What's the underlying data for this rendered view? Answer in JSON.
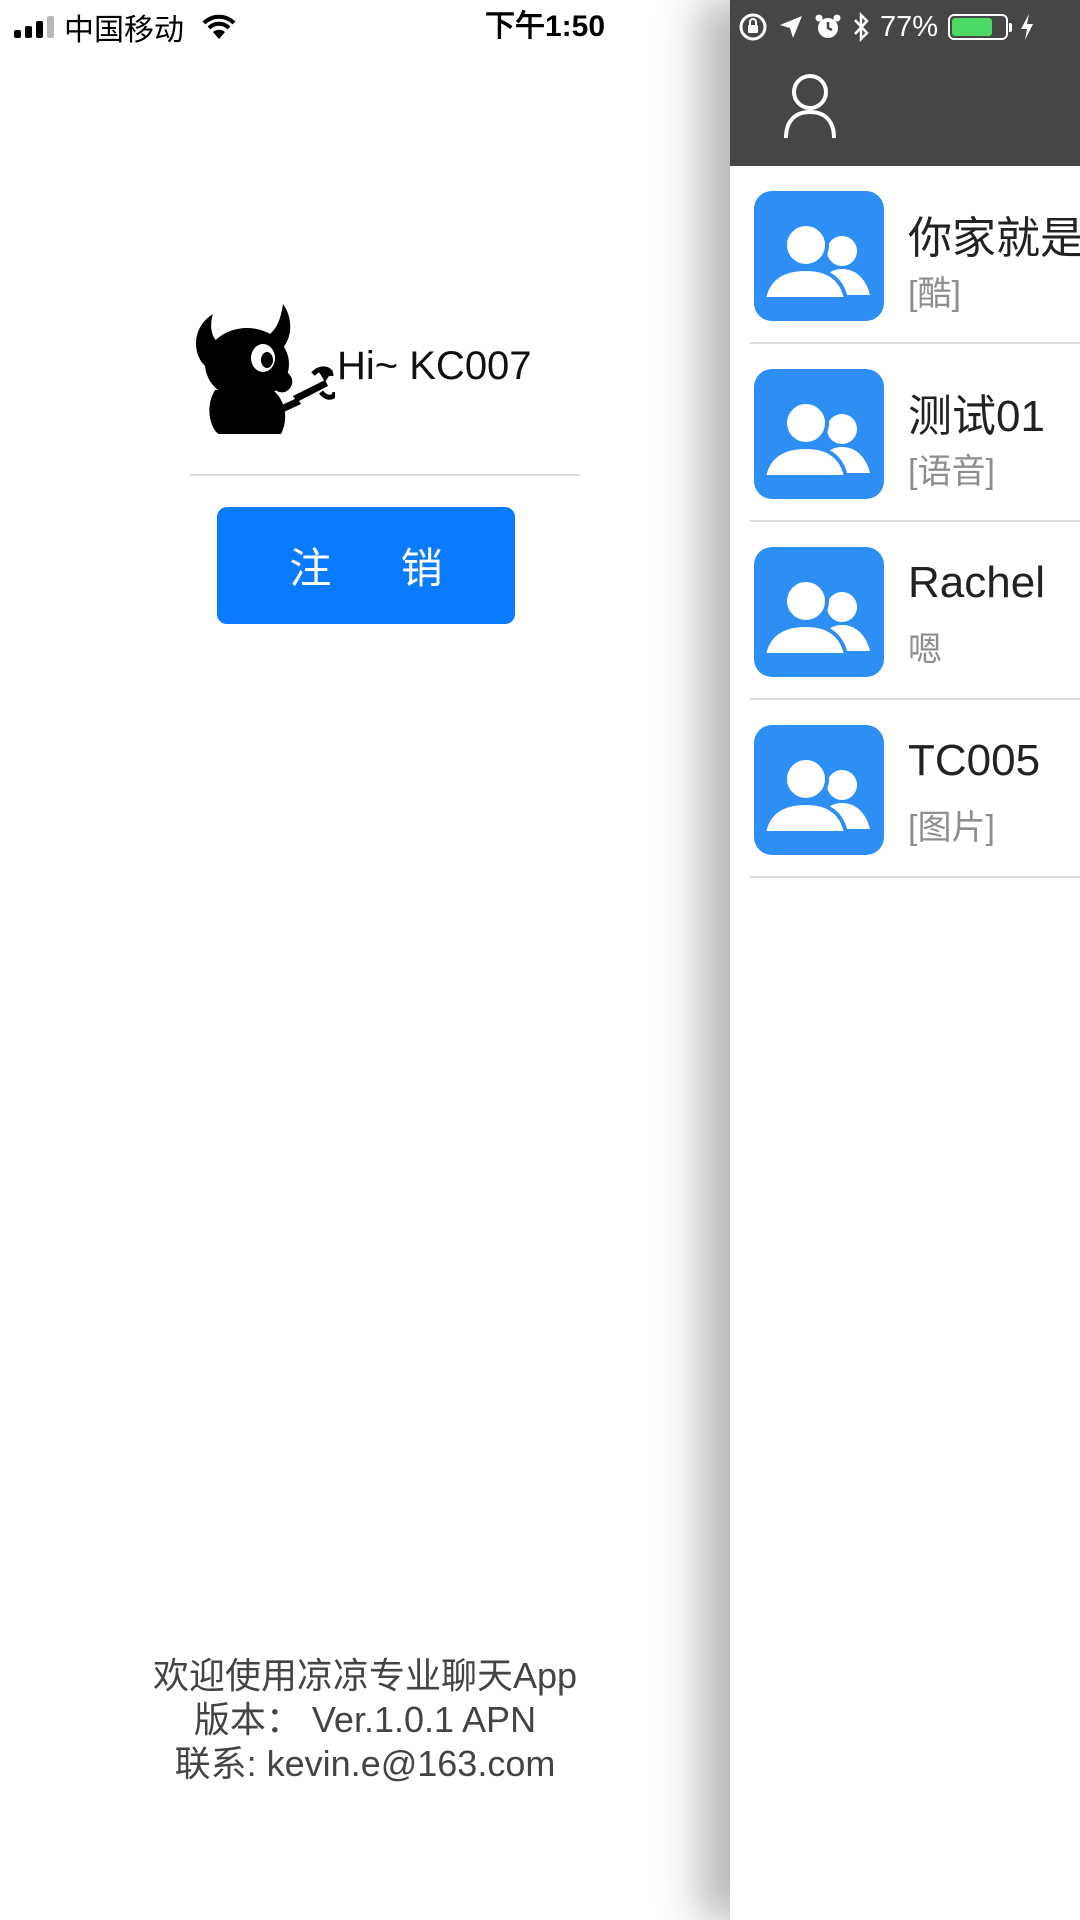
{
  "status_bar": {
    "carrier": "中国移动",
    "time": "下午1:50",
    "battery_percent": "77%",
    "battery_level": 0.77,
    "battery_color": "#4cd964",
    "icons": [
      "cellular-signal-icon",
      "wifi-icon",
      "rotation-lock-icon",
      "location-icon",
      "alarm-icon",
      "bluetooth-icon",
      "battery-icon",
      "charging-icon"
    ]
  },
  "drawer": {
    "greeting": "Hi~ KC007",
    "logout_label": "注 销",
    "logout_color": "#0a7aff",
    "footer": {
      "welcome": "欢迎使用凉凉专业聊天App",
      "version": "版本： Ver.1.0.1 APN",
      "contact": "联系: kevin.e@163.com"
    }
  },
  "panel": {
    "header_color": "#464646",
    "avatar_color": "#2d8ff3",
    "conversations": [
      {
        "name": "你家就是",
        "preview": "[酷]"
      },
      {
        "name": "测试01",
        "preview": "[语音]"
      },
      {
        "name": "Rachel",
        "preview": "嗯"
      },
      {
        "name": "TC005",
        "preview": "[图片]"
      }
    ]
  }
}
